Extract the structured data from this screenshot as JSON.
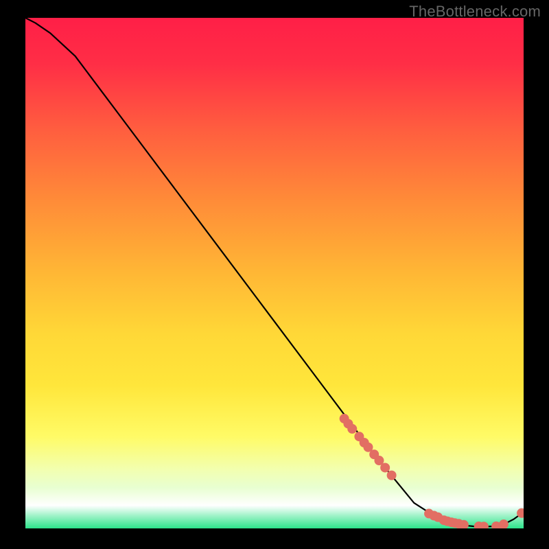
{
  "watermark": "TheBottleneck.com",
  "accent_colors": {
    "gradient_top": "#FF1F47",
    "gradient_yellow": "#FFE63B",
    "gradient_pale": "#E8FFD1",
    "gradient_white": "#FFFFFF",
    "gradient_green": "#2CE38B",
    "curve": "#000000",
    "dots": "#E26E63",
    "background": "#000000"
  },
  "chart_data": {
    "type": "line",
    "title": "",
    "xlabel": "",
    "ylabel": "",
    "xlim": [
      0,
      100
    ],
    "ylim": [
      0,
      100
    ],
    "series": [
      {
        "name": "curve",
        "x": [
          0,
          2,
          5,
          10,
          15,
          20,
          30,
          40,
          50,
          60,
          70,
          78,
          82,
          85,
          88,
          90,
          92,
          94,
          96,
          98,
          100
        ],
        "y": [
          100,
          99,
          97,
          92.5,
          86,
          79.5,
          66.5,
          53.5,
          40.5,
          27.5,
          14.5,
          5,
          2.5,
          1.2,
          0.6,
          0.4,
          0.35,
          0.4,
          0.8,
          1.8,
          3.2
        ]
      }
    ],
    "points": {
      "name": "dots",
      "x": [
        64,
        64.8,
        65.6,
        67,
        68,
        68.8,
        70,
        71,
        72.2,
        73.5,
        81,
        82,
        82.8,
        84,
        84.7,
        85.5,
        86.2,
        87,
        88,
        91,
        92,
        94.5,
        96,
        99.6
      ],
      "y": [
        21.5,
        20.5,
        19.5,
        18,
        16.8,
        15.9,
        14.5,
        13.3,
        11.9,
        10.4,
        2.9,
        2.5,
        2.2,
        1.6,
        1.4,
        1.2,
        1.05,
        0.9,
        0.7,
        0.4,
        0.37,
        0.42,
        0.8,
        3.0
      ]
    }
  }
}
